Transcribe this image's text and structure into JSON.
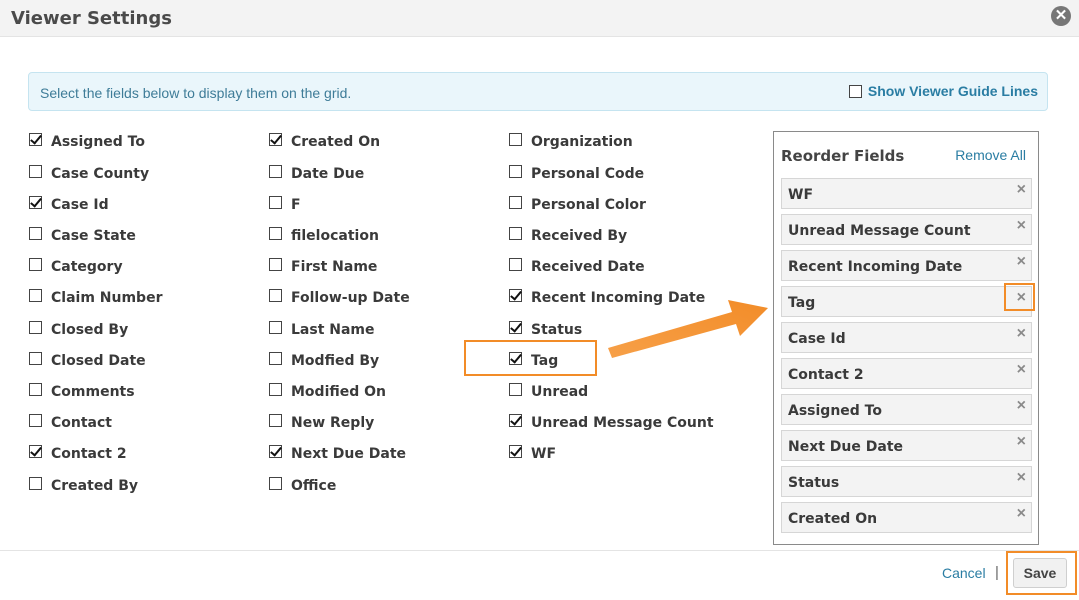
{
  "dialog": {
    "title": "Viewer Settings",
    "close_icon": "close-icon"
  },
  "info_bar": {
    "text": "Select the fields below to display them on the grid.",
    "guide_lines_label": "Show Viewer Guide Lines",
    "guide_lines_checked": false
  },
  "fields": {
    "column1": [
      {
        "label": "Assigned To",
        "checked": true
      },
      {
        "label": "Case County",
        "checked": false
      },
      {
        "label": "Case Id",
        "checked": true
      },
      {
        "label": "Case State",
        "checked": false
      },
      {
        "label": "Category",
        "checked": false
      },
      {
        "label": "Claim Number",
        "checked": false
      },
      {
        "label": "Closed By",
        "checked": false
      },
      {
        "label": "Closed Date",
        "checked": false
      },
      {
        "label": "Comments",
        "checked": false
      },
      {
        "label": "Contact",
        "checked": false
      },
      {
        "label": "Contact 2",
        "checked": true
      },
      {
        "label": "Created By",
        "checked": false
      }
    ],
    "column2": [
      {
        "label": "Created On",
        "checked": true
      },
      {
        "label": "Date Due",
        "checked": false
      },
      {
        "label": "F",
        "checked": false
      },
      {
        "label": "filelocation",
        "checked": false
      },
      {
        "label": "First Name",
        "checked": false
      },
      {
        "label": "Follow-up Date",
        "checked": false
      },
      {
        "label": "Last Name",
        "checked": false
      },
      {
        "label": "Modfied By",
        "checked": false
      },
      {
        "label": "Modified On",
        "checked": false
      },
      {
        "label": "New Reply",
        "checked": false
      },
      {
        "label": "Next Due Date",
        "checked": true
      },
      {
        "label": "Office",
        "checked": false
      }
    ],
    "column3": [
      {
        "label": "Organization",
        "checked": false
      },
      {
        "label": "Personal Code",
        "checked": false
      },
      {
        "label": "Personal Color",
        "checked": false
      },
      {
        "label": "Received By",
        "checked": false
      },
      {
        "label": "Received Date",
        "checked": false
      },
      {
        "label": "Recent Incoming Date",
        "checked": true
      },
      {
        "label": "Status",
        "checked": true
      },
      {
        "label": "Tag",
        "checked": true
      },
      {
        "label": "Unread",
        "checked": false
      },
      {
        "label": "Unread Message Count",
        "checked": true
      },
      {
        "label": "WF",
        "checked": true
      }
    ]
  },
  "reorder": {
    "title": "Reorder Fields",
    "remove_all_label": "Remove All",
    "items": [
      {
        "label": "WF"
      },
      {
        "label": "Unread Message Count"
      },
      {
        "label": "Recent Incoming Date"
      },
      {
        "label": "Tag"
      },
      {
        "label": "Case Id"
      },
      {
        "label": "Contact 2"
      },
      {
        "label": "Assigned To"
      },
      {
        "label": "Next Due Date"
      },
      {
        "label": "Status"
      },
      {
        "label": "Created On"
      }
    ],
    "remove_icon": "×"
  },
  "footer": {
    "cancel_label": "Cancel",
    "separator": "|",
    "save_label": "Save"
  },
  "colors": {
    "accent": "#2a7da3",
    "highlight": "#f28c28",
    "info_bg": "#eaf6fb"
  }
}
